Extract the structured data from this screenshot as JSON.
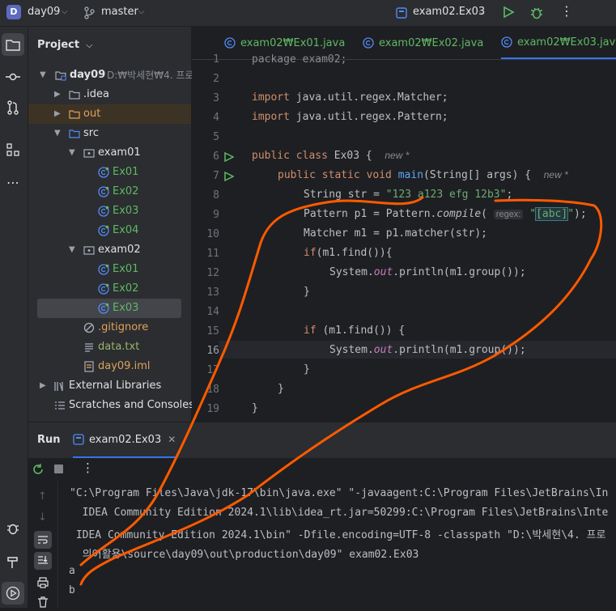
{
  "titlebar": {
    "project_badge": "D",
    "project_name": "day09",
    "branch_icon": "branch-icon",
    "branch": "master",
    "run_config": "exam02.Ex03",
    "run_icon": "play-icon",
    "debug_icon": "bug-icon",
    "more_icon": "kebab-icon"
  },
  "left_tools": [
    "folder-icon",
    "commit-icon",
    "pull-request-icon",
    "structure-icon",
    "more-icon"
  ],
  "left_tools_bottom": [
    "bug-icon",
    "hammer-icon",
    "run-icon"
  ],
  "project_panel": {
    "title": "Project",
    "root": {
      "name": "day09",
      "path": "D:₩박세현₩4. 프로"
    },
    "items": [
      {
        "label": ".idea",
        "type": "folder",
        "indent": 1,
        "arrow": "right"
      },
      {
        "label": "out",
        "type": "folder-excluded",
        "indent": 1,
        "arrow": "right"
      },
      {
        "label": "src",
        "type": "folder-src",
        "indent": 1,
        "arrow": "down"
      },
      {
        "label": "exam01",
        "type": "package",
        "indent": 2,
        "arrow": "down"
      },
      {
        "label": "Ex01",
        "type": "class",
        "indent": 3
      },
      {
        "label": "Ex02",
        "type": "class",
        "indent": 3
      },
      {
        "label": "Ex03",
        "type": "class",
        "indent": 3
      },
      {
        "label": "Ex04",
        "type": "class",
        "indent": 3
      },
      {
        "label": "exam02",
        "type": "package",
        "indent": 2,
        "arrow": "down"
      },
      {
        "label": "Ex01",
        "type": "class",
        "indent": 3
      },
      {
        "label": "Ex02",
        "type": "class",
        "indent": 3
      },
      {
        "label": "Ex03",
        "type": "class",
        "indent": 3,
        "selected": true
      },
      {
        "label": ".gitignore",
        "type": "ignore",
        "indent": 2
      },
      {
        "label": "data.txt",
        "type": "text",
        "indent": 2
      },
      {
        "label": "day09.iml",
        "type": "iml",
        "indent": 2
      },
      {
        "label": "External Libraries",
        "type": "libs",
        "indent": 0,
        "arrow": "right"
      },
      {
        "label": "Scratches and Consoles",
        "type": "scratch",
        "indent": 0
      }
    ]
  },
  "editor": {
    "tabs": [
      {
        "label": "exam02₩Ex01.java",
        "active": false
      },
      {
        "label": "exam02₩Ex02.java",
        "active": false
      },
      {
        "label": "exam02₩Ex03.java",
        "active": true
      }
    ],
    "line_numbers": [
      "1",
      "2",
      "3",
      "4",
      "5",
      "6",
      "7",
      "8",
      "9",
      "10",
      "11",
      "12",
      "13",
      "14",
      "15",
      "16",
      "17",
      "18",
      "19"
    ],
    "current_line": "16",
    "code": {
      "l1": "package exam02;",
      "l3_kw": "import",
      "l3_rest": " java.util.regex.Matcher;",
      "l4_kw": "import",
      "l4_rest": " java.util.regex.Pattern;",
      "l6_kw": "public class",
      "l6_rest": " Ex03 {",
      "l6_hint": "new *",
      "l7_kw": "public static void",
      "l7_fn": "main",
      "l7_rest": "(String[] args) {",
      "l7_hint": "new *",
      "l8_a": "String str = ",
      "l8_str": "\"123 a123 efg 12b3\"",
      "l8_b": ";",
      "l9_a": "Pattern p1 = Pattern.",
      "l9_it": "compile",
      "l9_b": "(",
      "l9_chip": "regex:",
      "l9_str1": "\"",
      "l9_str2": "[abc]",
      "l9_str3": "\"",
      "l9_c": ");",
      "l10": "Matcher m1 = p1.matcher(str);",
      "l11_kw": "if",
      "l11_rest": "(m1.find()){",
      "l12_a": "System.",
      "l12_f": "out",
      "l12_b": ".println(m1.group());",
      "l13": "}",
      "l15_kw": "if",
      "l15_rest": " (m1.find()) {",
      "l16_a": "System.",
      "l16_f": "out",
      "l16_b": ".println(m1.group());",
      "l17": "}",
      "l18": "}",
      "l19": "}"
    }
  },
  "run_panel": {
    "title": "Run",
    "tab": "exam02.Ex03",
    "console": [
      "\"C:\\Program Files\\Java\\jdk-17\\bin\\java.exe\" \"-javaagent:C:\\Program Files\\JetBrains\\In",
      "  IDEA Community Edition 2024.1\\lib\\idea_rt.jar=50299:C:\\Program Files\\JetBrains\\Inte",
      " IDEA Community Edition 2024.1\\bin\" -Dfile.encoding=UTF-8 -classpath \"D:\\박세현\\4. 프로",
      "  의어활용\\source\\day09\\out\\production\\day09\" exam02.Ex03",
      "a",
      "b"
    ]
  },
  "colors": {
    "annotation": "#ff5a00",
    "accent": "#3574f0",
    "class_green": "#5fb865"
  }
}
